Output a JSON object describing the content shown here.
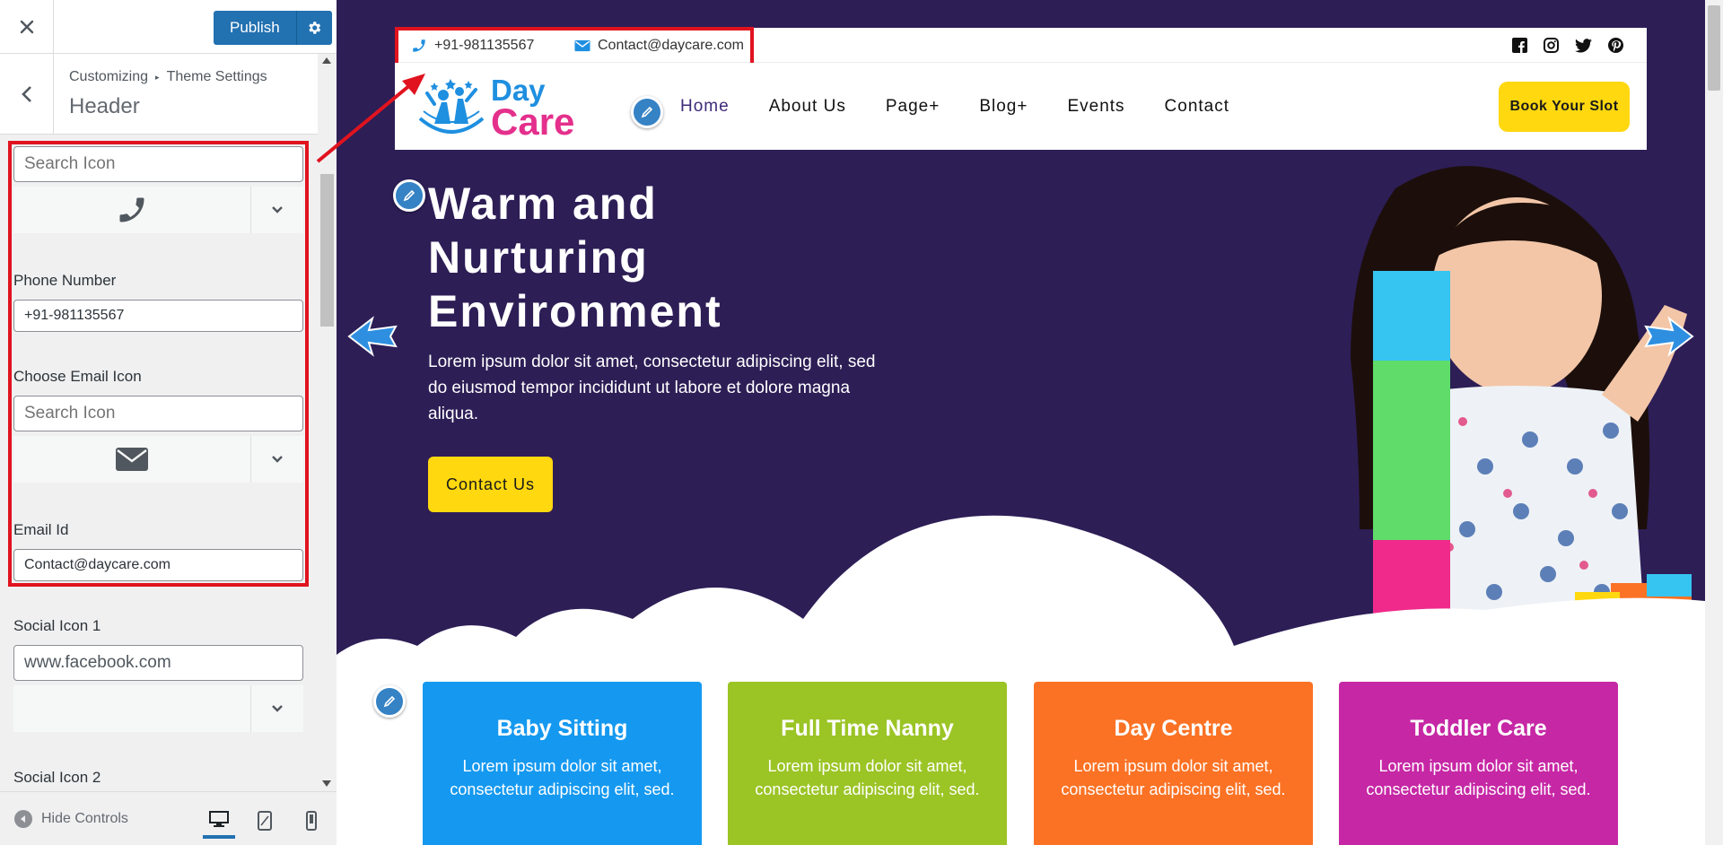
{
  "customizer": {
    "publish_label": "Publish",
    "breadcrumb": [
      "Customizing",
      "Theme Settings"
    ],
    "section_title": "Header",
    "controls": {
      "phone_icon_search_placeholder": "Search Icon",
      "phone_label": "Phone Number",
      "phone_value": "+91-981135567",
      "email_icon_label": "Choose Email Icon",
      "email_icon_search_placeholder": "Search Icon",
      "email_label": "Email Id",
      "email_value": "Contact@daycare.com",
      "social1_label": "Social Icon 1",
      "social1_value": "www.facebook.com",
      "social2_label": "Social Icon 2"
    },
    "footer": {
      "hide_controls_label": "Hide Controls"
    }
  },
  "site": {
    "topbar": {
      "phone": "+91-981135567",
      "email": "Contact@daycare.com"
    },
    "logo": {
      "line1": "Day",
      "line2": "Care"
    },
    "nav": [
      "Home",
      "About Us",
      "Page+",
      "Blog+",
      "Events",
      "Contact"
    ],
    "book_button": "Book Your Slot",
    "hero": {
      "title_lines": [
        "Warm and",
        "Nurturing",
        "Environment"
      ],
      "text": "Lorem ipsum dolor sit amet, consectetur adipiscing elit, sed do eiusmod tempor incididunt ut labore et dolore magna aliqua.",
      "cta": "Contact Us"
    },
    "services": [
      {
        "title": "Baby Sitting",
        "text": "Lorem ipsum dolor sit amet, consectetur adipiscing elit, sed.",
        "color": "#1599f0"
      },
      {
        "title": "Full Time Nanny",
        "text": "Lorem ipsum dolor sit amet, consectetur adipiscing elit, sed.",
        "color": "#9bc425"
      },
      {
        "title": "Day Centre",
        "text": "Lorem ipsum dolor sit amet, consectetur adipiscing elit, sed.",
        "color": "#fb7224"
      },
      {
        "title": "Toddler Care",
        "text": "Lorem ipsum dolor sit amet, consectetur adipiscing elit, sed.",
        "color": "#c627a5"
      }
    ]
  },
  "colors": {
    "wp_blue": "#2271b1",
    "hero_bg": "#2d1e56",
    "highlight_red": "#e0131f",
    "cta_yellow": "#ffd80f"
  }
}
